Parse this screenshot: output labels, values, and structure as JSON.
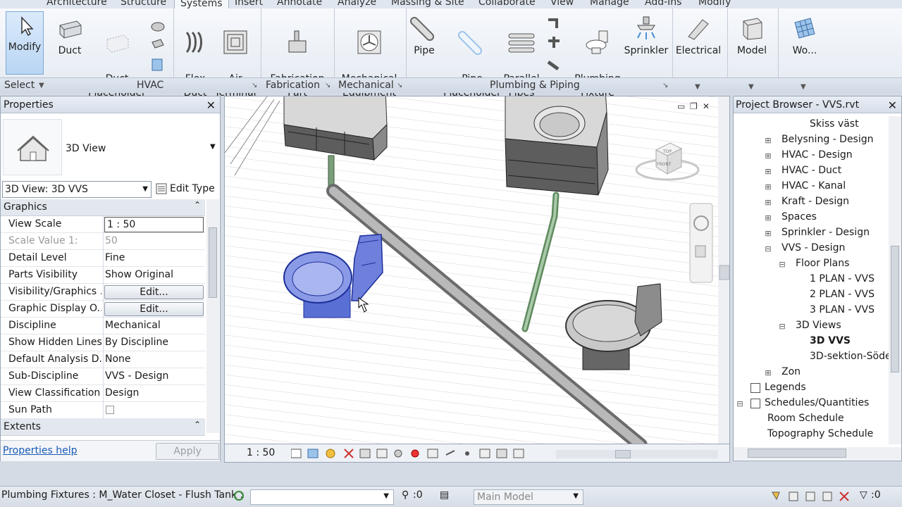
{
  "tabs": [
    "Architecture",
    "Structure",
    "Systems",
    "Insert",
    "Annotate",
    "Analyze",
    "Massing & Site",
    "Collaborate",
    "View",
    "Manage",
    "Add-Ins",
    "Modify"
  ],
  "ribbon": {
    "modify": "Modify",
    "duct": "Duct",
    "duct_placeholder": "Duct\nPlaceholder",
    "flex_duct": "Flex\nDuct",
    "air_terminal": "Air\nTerminal",
    "fabrication_part": "Fabrication\nPart",
    "mechanical_equipment": "Mechanical\nEquipment",
    "pipe": "Pipe",
    "pipe_placeholder": "Pipe\nPlaceholder",
    "parallel_pipes": "Parallel\nPipes",
    "plumbing_fixture": "Plumbing\nFixture",
    "sprinkler": "Sprinkler",
    "electrical": "Electrical",
    "model": "Model",
    "wo": "Wo..."
  },
  "panels": {
    "select": "Select",
    "hvac": "HVAC",
    "fabrication": "Fabrication",
    "mechanical": "Mechanical",
    "plumbing": "Plumbing & Piping"
  },
  "properties": {
    "title": "Properties",
    "type_name": "3D View",
    "instance_selector": "3D View: 3D  VVS",
    "edit_type": "Edit Type",
    "group_graphics": "Graphics",
    "group_extents": "Extents",
    "rows": [
      {
        "k": "View Scale",
        "v": "1 : 50"
      },
      {
        "k": "Scale Value    1:",
        "v": "50"
      },
      {
        "k": "Detail Level",
        "v": "Fine"
      },
      {
        "k": "Parts Visibility",
        "v": "Show Original"
      },
      {
        "k": "Visibility/Graphics ...",
        "v": "Edit..."
      },
      {
        "k": "Graphic Display O...",
        "v": "Edit..."
      },
      {
        "k": "Discipline",
        "v": "Mechanical"
      },
      {
        "k": "Show Hidden Lines",
        "v": "By Discipline"
      },
      {
        "k": "Default Analysis D...",
        "v": "None"
      },
      {
        "k": "Sub-Discipline",
        "v": "VVS - Design"
      },
      {
        "k": "View Classification",
        "v": "Design"
      },
      {
        "k": "Sun Path",
        "v": ""
      }
    ],
    "help": "Properties help",
    "apply": "Apply"
  },
  "view": {
    "scale": "1 : 50",
    "cube_top": "TOP",
    "cube_front": "FRONT"
  },
  "browser": {
    "title": "Project Browser - VVS.rvt",
    "items": [
      "Skiss väst",
      "Belysning - Design",
      "HVAC - Design",
      "HVAC - Duct",
      "HVAC - Kanal",
      "Kraft - Design",
      "Spaces",
      "Sprinkler - Design",
      "VVS - Design",
      "Floor Plans",
      "1 PLAN - VVS",
      "2 PLAN -  VVS",
      "3 PLAN -  VVS",
      "3D Views",
      "3D  VVS",
      "3D-sektion-Söde",
      "Zon",
      "Legends",
      "Schedules/Quantities",
      "Room Schedule",
      "Topography Schedule"
    ]
  },
  "status": {
    "text": "Plumbing Fixtures : M_Water Closet - Flush Tank :",
    "count": ":0",
    "model": "Main Model",
    "filter": ":0"
  }
}
